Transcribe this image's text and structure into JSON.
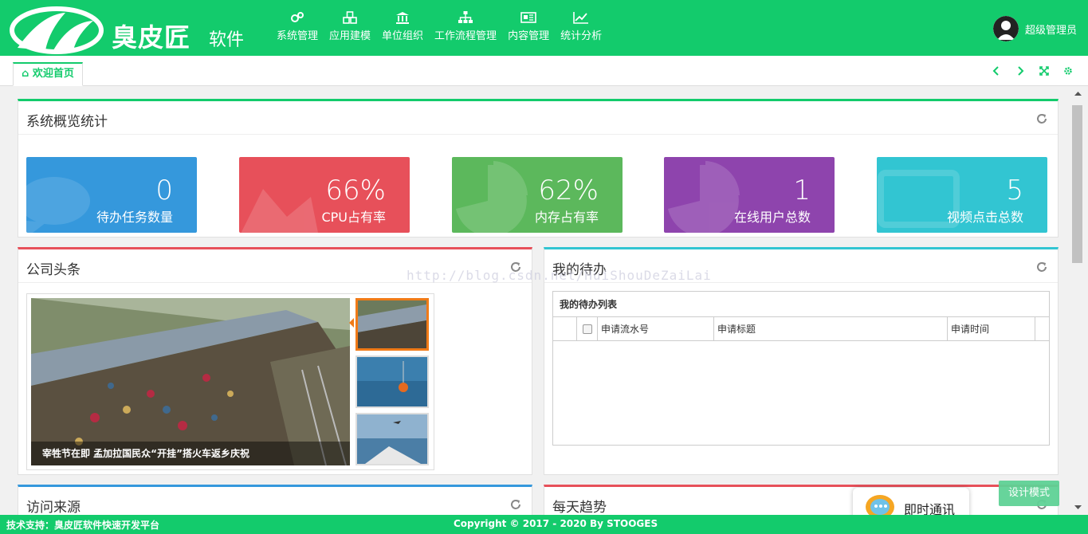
{
  "brand": {
    "name": "臭皮匠",
    "sub": "软件"
  },
  "nav": [
    {
      "label": "系统管理",
      "icon": "gears-icon"
    },
    {
      "label": "应用建模",
      "icon": "cubes-icon"
    },
    {
      "label": "单位组织",
      "icon": "bank-icon"
    },
    {
      "label": "工作流程管理",
      "icon": "sitemap-icon"
    },
    {
      "label": "内容管理",
      "icon": "newspaper-icon"
    },
    {
      "label": "统计分析",
      "icon": "line-chart-icon"
    }
  ],
  "user": {
    "name": "超级管理员"
  },
  "tabs": {
    "home": "欢迎首页"
  },
  "overview": {
    "title": "系统概览统计",
    "stats": [
      {
        "value": "0",
        "label": "待办任务数量",
        "color": "#3598dc"
      },
      {
        "value": "66%",
        "label": "CPU占有率",
        "color": "#e7505a"
      },
      {
        "value": "62%",
        "label": "内存占有率",
        "color": "#5cb85c"
      },
      {
        "value": "1",
        "label": "在线用户总数",
        "color": "#8e44ad"
      },
      {
        "value": "5",
        "label": "视频点击总数",
        "color": "#32c5d2"
      }
    ]
  },
  "news": {
    "title": "公司头条",
    "caption": "宰牲节在即 孟加拉国民众“开挂”搭火车返乡庆祝"
  },
  "todo": {
    "title": "我的待办",
    "list_title": "我的待办列表",
    "columns": [
      "申请流水号",
      "申请标题",
      "申请时间"
    ]
  },
  "visits": {
    "title": "访问来源"
  },
  "trend": {
    "title": "每天趋势"
  },
  "watermark": "http://blog.csdn.net/HuiShouDeZaiLai",
  "im": {
    "label": "即时通讯"
  },
  "design_mode": "设计模式",
  "footer": {
    "left": "技术支持：臭皮匠软件快速开发平台",
    "center": "Copyright © 2017 - 2020 By STOOGES"
  },
  "colors": {
    "brand": "#13cb6c"
  }
}
